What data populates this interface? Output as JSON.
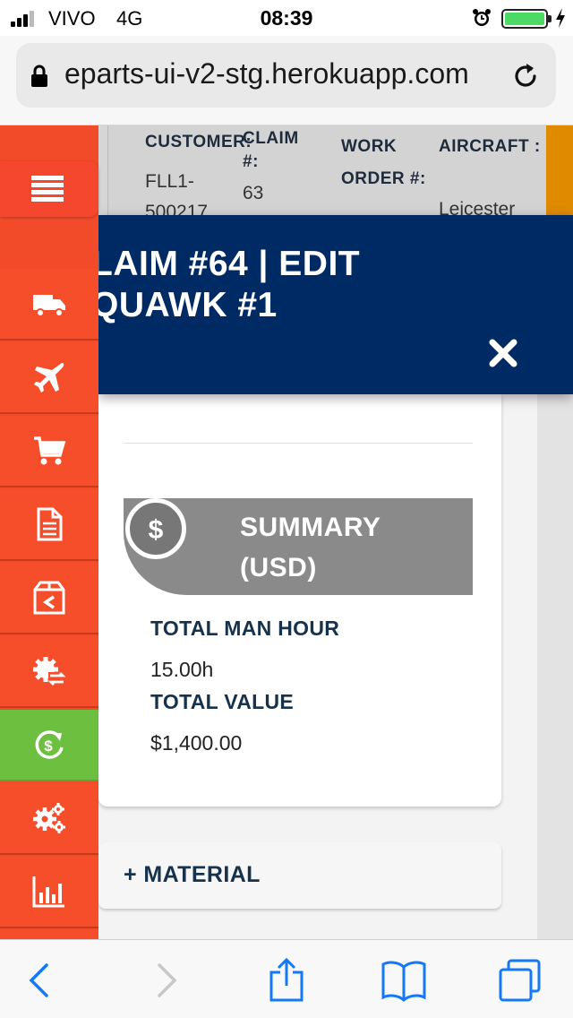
{
  "status_bar": {
    "carrier": "VIVO",
    "network": "4G",
    "time": "08:39",
    "battery_level": 1.0
  },
  "browser": {
    "url": "eparts-ui-v2-stg.herokuapp.com"
  },
  "background_table": {
    "columns": [
      {
        "label": "CUSTOMER:",
        "value": "FLL1-500217"
      },
      {
        "label": "CLAIM #:",
        "value": "63"
      },
      {
        "label": "WORK ORDER #:",
        "value": ""
      },
      {
        "label": "AIRCRAFT :",
        "value": "Leicester"
      }
    ]
  },
  "modal": {
    "title_line1": "LAIM #64 | EDIT",
    "title_line2": "QUAWK #1",
    "summary": {
      "title_line1": "SUMMARY",
      "title_line2": "(USD)",
      "total_man_hour_label": "TOTAL MAN HOUR",
      "total_man_hour_value": "15.00h",
      "total_value_label": "TOTAL VALUE",
      "total_value_value": "$1,400.00"
    },
    "material_label": "+ MATERIAL"
  },
  "sidebar": {
    "items": [
      {
        "icon": "truck-icon"
      },
      {
        "icon": "airplane-icon"
      },
      {
        "icon": "cart-icon"
      },
      {
        "icon": "document-icon"
      },
      {
        "icon": "box-return-icon"
      },
      {
        "icon": "gear-exchange-icon"
      },
      {
        "icon": "dollar-refresh-icon",
        "active": true
      },
      {
        "icon": "gears-icon"
      },
      {
        "icon": "bar-chart-icon"
      }
    ]
  },
  "colors": {
    "sidebar": "#f64d2b",
    "sidebar_active": "#6cbf3f",
    "modal_header": "#002a63",
    "summary_banner": "#8a8a8a",
    "label_text": "#17324d"
  }
}
